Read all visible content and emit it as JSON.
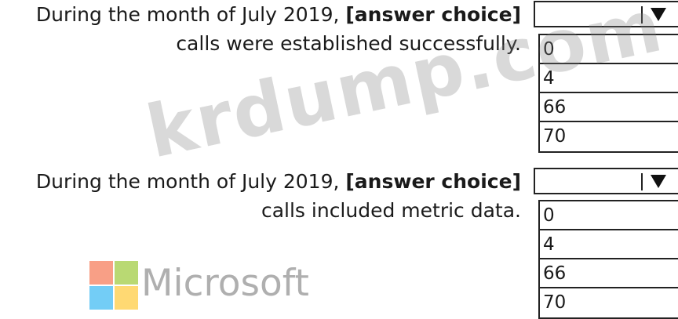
{
  "questions": [
    {
      "prefix": "During the month of July 2019, ",
      "choice": "[answer choice]",
      "line2": "calls were established successfully.",
      "selected": "",
      "options": [
        "0",
        "4",
        "66",
        "70"
      ]
    },
    {
      "prefix": "During the month of July 2019, ",
      "choice": "[answer choice]",
      "line2": "calls included metric data.",
      "selected": "",
      "options": [
        "0",
        "4",
        "66",
        "70"
      ]
    }
  ],
  "watermark": {
    "text": "krdump.com"
  },
  "brand": {
    "name": "Microsoft",
    "colors": {
      "red": "#f25022",
      "green": "#7fba00",
      "blue": "#00a4ef",
      "yellow": "#ffb900"
    }
  }
}
